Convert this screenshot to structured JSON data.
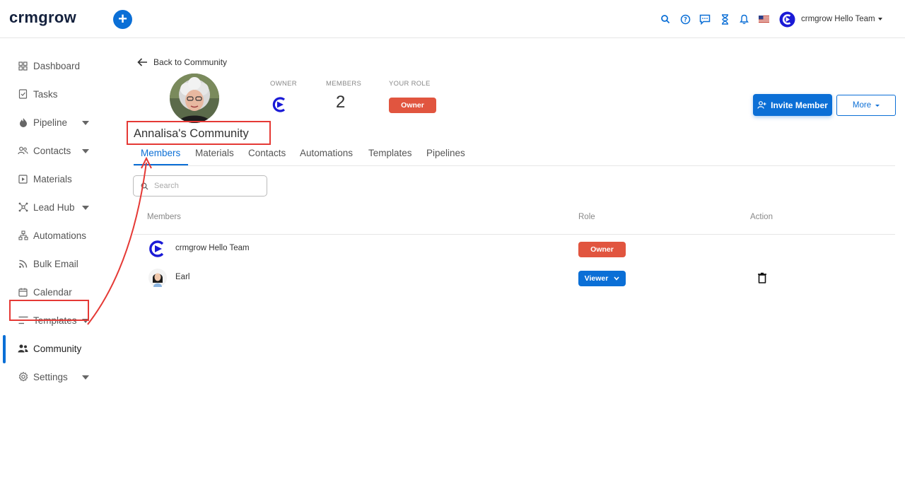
{
  "app": {
    "logo_text": "crmgrow"
  },
  "header": {
    "user_name": "crmgrow Hello Team",
    "icons": [
      "search-icon",
      "help-icon",
      "chat-icon",
      "hourglass-icon",
      "bell-icon",
      "us-flag-icon"
    ]
  },
  "sidebar": {
    "items": [
      {
        "label": "Dashboard",
        "icon": "dashboard-icon",
        "has_caret": false
      },
      {
        "label": "Tasks",
        "icon": "tasks-icon",
        "has_caret": false
      },
      {
        "label": "Pipeline",
        "icon": "pipeline-icon",
        "has_caret": true
      },
      {
        "label": "Contacts",
        "icon": "contacts-icon",
        "has_caret": true
      },
      {
        "label": "Materials",
        "icon": "materials-icon",
        "has_caret": false
      },
      {
        "label": "Lead Hub",
        "icon": "lead-hub-icon",
        "has_caret": true
      },
      {
        "label": "Automations",
        "icon": "automations-icon",
        "has_caret": false
      },
      {
        "label": "Bulk Email",
        "icon": "bulk-email-icon",
        "has_caret": false
      },
      {
        "label": "Calendar",
        "icon": "calendar-icon",
        "has_caret": false
      },
      {
        "label": "Templates",
        "icon": "templates-icon",
        "has_caret": true
      },
      {
        "label": "Community",
        "icon": "community-icon",
        "has_caret": false,
        "active": true
      },
      {
        "label": "Settings",
        "icon": "settings-icon",
        "has_caret": true
      }
    ]
  },
  "main": {
    "back_label": "Back to Community",
    "stats": {
      "owner_label": "OWNER",
      "members_label": "MEMBERS",
      "members_count": "2",
      "role_label": "YOUR ROLE",
      "role_value": "Owner"
    },
    "invite_label": "Invite Member",
    "more_label": "More",
    "title": "Annalisa's Community",
    "tabs": [
      "Members",
      "Materials",
      "Contacts",
      "Automations",
      "Templates",
      "Pipelines"
    ],
    "active_tab": "Members",
    "search": {
      "placeholder": "Search",
      "value": ""
    },
    "table": {
      "headers": {
        "members": "Members",
        "role": "Role",
        "action": "Action"
      },
      "rows": [
        {
          "name": "crmgrow Hello Team",
          "role": "Owner"
        },
        {
          "name": "Earl",
          "role": "Viewer"
        }
      ]
    }
  },
  "colors": {
    "primary": "#0b6fd6",
    "owner_badge": "#e1553f",
    "highlight": "#e53935"
  }
}
